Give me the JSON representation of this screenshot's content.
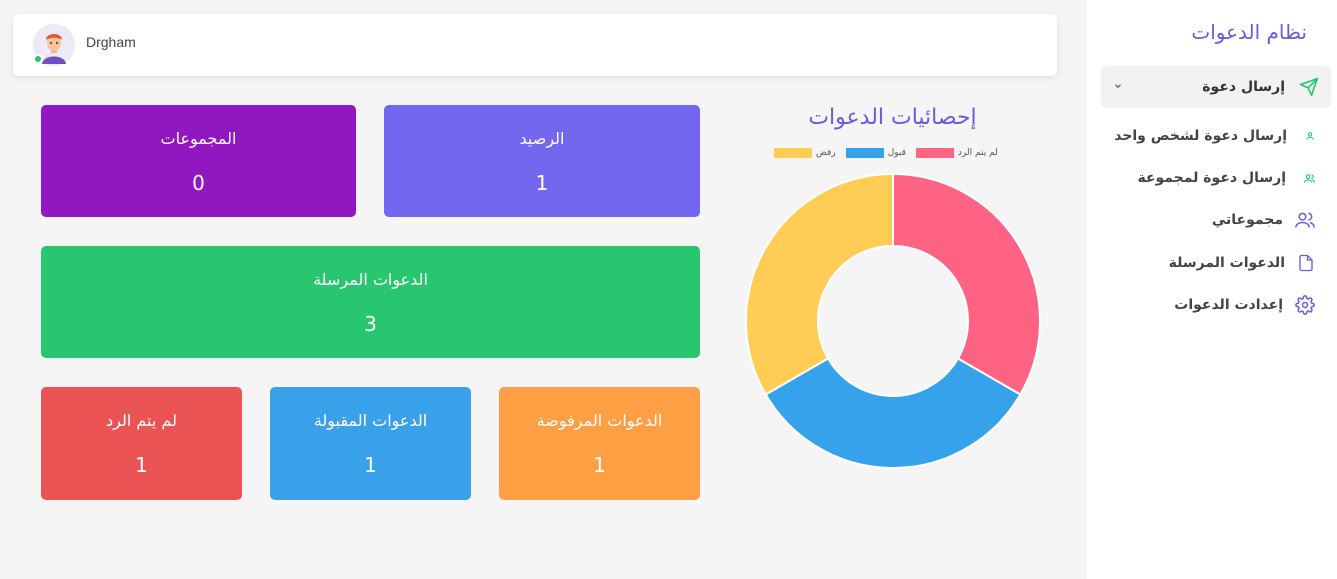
{
  "sidebar": {
    "brand": "نظام الدعوات",
    "parent": {
      "label": "إرسال دعوة",
      "icon": "send-icon",
      "color": "#28c76f"
    },
    "sub_items": [
      {
        "label": "إرسال دعوة لشخص واحد",
        "icon": "user-icon"
      },
      {
        "label": "إرسال دعوة لمجموعة",
        "icon": "users-icon"
      }
    ],
    "items": [
      {
        "label": "مجموعاتي",
        "icon": "users-icon"
      },
      {
        "label": "الدعوات المرسلة",
        "icon": "file-icon"
      },
      {
        "label": "إعدادت الدعوات",
        "icon": "gear-icon"
      }
    ]
  },
  "header": {
    "username": "Drgham"
  },
  "cards": {
    "balance": {
      "title": "الرصيد",
      "value": "1",
      "color": "#7367f0"
    },
    "groups": {
      "title": "المجموعات",
      "value": "0",
      "color": "#9118c1"
    },
    "sent": {
      "title": "الدعوات المرسلة",
      "value": "3",
      "color": "#28c76f"
    },
    "rejected": {
      "title": "الدعوات المرفوضة",
      "value": "1",
      "color": "#ff9f43"
    },
    "accepted": {
      "title": "الدعوات المقبولة",
      "value": "1",
      "color": "#39a1ea"
    },
    "no_reply": {
      "title": "لم يتم الرد",
      "value": "1",
      "color": "#ea5455"
    }
  },
  "chart_data": {
    "type": "pie",
    "title": "إحصائيات الدعوات",
    "categories": [
      "لم يتم الرد",
      "قبول",
      "رفض"
    ],
    "values": [
      1,
      1,
      1
    ],
    "colors": [
      "#ff6384",
      "#36a2eb",
      "#ffcd56"
    ],
    "legend": "top"
  }
}
